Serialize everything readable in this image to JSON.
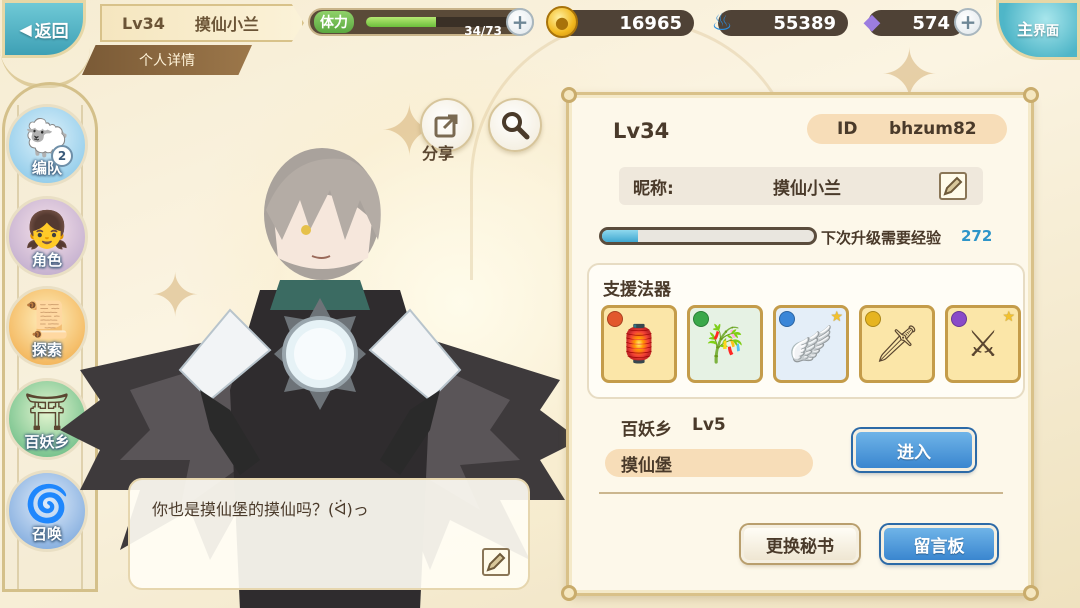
{
  "top_bar": {
    "back_label": "返回",
    "level": "Lv34",
    "player_name": "摸仙小兰",
    "detail_tab": "个人详情",
    "stamina": {
      "label": "体力",
      "current": 34,
      "max": 73,
      "text": "34/73"
    },
    "gold": "16965",
    "spirit_flame": "55389",
    "crystal": "574",
    "home_label_line1": "主",
    "home_label_line2": "界面"
  },
  "sidebar": {
    "items": [
      {
        "label": "编队",
        "badge": "2",
        "icon": "team-icon"
      },
      {
        "label": "角色",
        "icon": "character-icon"
      },
      {
        "label": "探索",
        "icon": "explore-icon"
      },
      {
        "label": "百妖乡",
        "icon": "village-icon"
      },
      {
        "label": "召唤",
        "icon": "summon-icon"
      }
    ]
  },
  "actions": {
    "share_label": "分享"
  },
  "dialog": {
    "text": "你也是摸仙堡的摸仙吗？(ᐛ)っ"
  },
  "profile": {
    "level": "Lv34",
    "id_label": "ID",
    "id_value": "bhzum82",
    "nickname_label": "昵称:",
    "nickname": "摸仙小兰",
    "exp_label": "下次升级需要经验",
    "exp_needed": "272",
    "exp_progress": 0.17,
    "support_title": "支援法器",
    "support_items": [
      {
        "name": "red-lantern-artifact",
        "element": "fire",
        "element_color": "#e2572c",
        "bg": "#fbe6a8",
        "starred": false
      },
      {
        "name": "green-jade-artifact",
        "element": "wind",
        "element_color": "#3aa84a",
        "bg": "#e6f2e4",
        "starred": false
      },
      {
        "name": "blue-wings-artifact",
        "element": "water",
        "element_color": "#3a86d8",
        "bg": "#e4eef8",
        "starred": true
      },
      {
        "name": "golden-blade-artifact",
        "element": "light",
        "element_color": "#e6b420",
        "bg": "#fbe6a8",
        "starred": false
      },
      {
        "name": "violet-sword-artifact",
        "element": "dark",
        "element_color": "#8a4ac8",
        "bg": "#fbe6a8",
        "starred": true
      }
    ],
    "village_name": "百妖乡",
    "village_level": "Lv5",
    "village_owner": "摸仙堡",
    "enter_label": "进入",
    "swap_secretary_label": "更换秘书",
    "message_board_label": "留言板"
  },
  "colors": {
    "accent_blue": "#3a86cf",
    "panel_border": "#d9c189",
    "exp_blue": "#2e95c9"
  }
}
